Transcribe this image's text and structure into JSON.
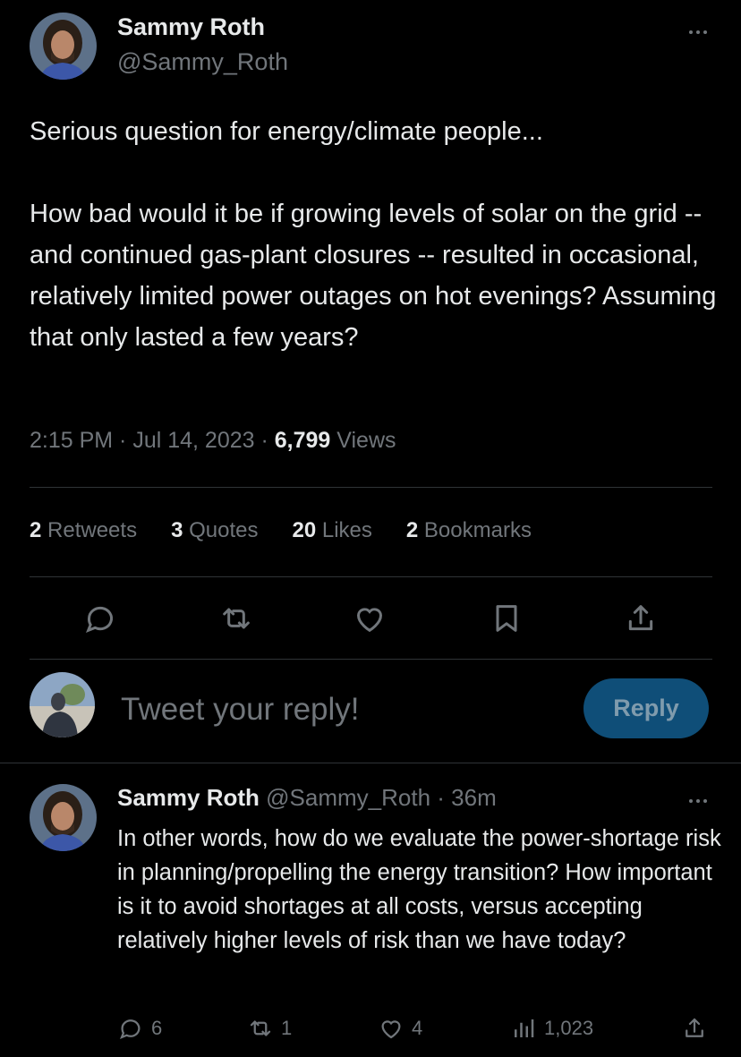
{
  "tweet": {
    "author_name": "Sammy Roth",
    "author_handle": "@Sammy_Roth",
    "text": "Serious question for energy/climate people...\n\nHow bad would it be if growing levels of solar on the grid -- and continued gas-plant closures -- resulted in occasional, relatively limited power outages on hot evenings? Assuming that only lasted a few years?",
    "time": "2:15 PM · Jul 14, 2023 · ",
    "views_count": "6,799",
    "views_label": " Views"
  },
  "stats": {
    "retweets_count": "2",
    "retweets_label": " Retweets",
    "quotes_count": "3",
    "quotes_label": " Quotes",
    "likes_count": "20",
    "likes_label": " Likes",
    "bookmarks_count": "2",
    "bookmarks_label": " Bookmarks"
  },
  "actions": [
    "reply-icon",
    "retweet-icon",
    "heart-icon",
    "bookmark-icon",
    "share-icon"
  ],
  "composer": {
    "placeholder": "Tweet your reply!",
    "button_label": "Reply"
  },
  "reply": {
    "author_name": "Sammy Roth",
    "author_handle": " @Sammy_Roth · 36m",
    "text": "In other words, how do we evaluate the power-shortage risk in planning/propelling the energy transition? How important is it to avoid shortages at all costs, versus accepting relatively higher levels of risk than we have today?",
    "replies": "6",
    "retweets": "1",
    "likes": "4",
    "views": "1,023"
  },
  "colors": {
    "background": "#000000",
    "text": "#e7e9ea",
    "muted": "#71767b",
    "divider": "#2f3336",
    "reply_button": "#0f4e78"
  }
}
